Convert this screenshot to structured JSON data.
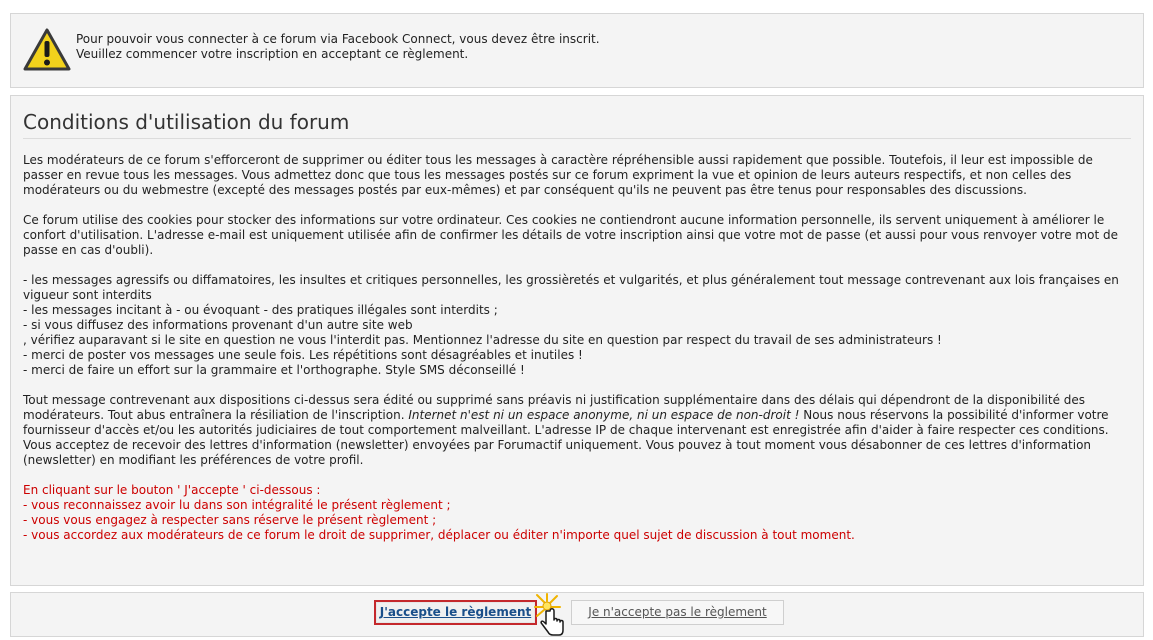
{
  "notice": {
    "icon": "warning-icon",
    "line1": "Pour pouvoir vous connecter à ce forum via Facebook Connect, vous devez être inscrit.",
    "line2": "Veuillez commencer votre inscription en acceptant ce règlement."
  },
  "terms": {
    "title": "Conditions d'utilisation du forum",
    "p1": "Les modérateurs de ce forum s'efforceront de supprimer ou éditer tous les messages à caractère répréhensible aussi rapidement que possible. Toutefois, il leur est impossible de passer en revue tous les messages. Vous admettez donc que tous les messages postés sur ce forum expriment la vue et opinion de leurs auteurs respectifs, et non celles des modérateurs ou du webmestre (excepté des messages postés par eux-mêmes) et par conséquent qu'ils ne peuvent pas être tenus pour responsables des discussions.",
    "p2": "Ce forum utilise des cookies pour stocker des informations sur votre ordinateur. Ces cookies ne contiendront aucune information personnelle, ils servent uniquement à améliorer le confort d'utilisation. L'adresse e-mail est uniquement utilisée afin de confirmer les détails de votre inscription ainsi que votre mot de passe (et aussi pour vous renvoyer votre mot de passe en cas d'oubli).",
    "rules": [
      "- les messages agressifs ou diffamatoires, les insultes et critiques personnelles, les grossièretés et vulgarités, et plus généralement tout message contrevenant aux lois françaises en vigueur sont interdits",
      "- les messages incitant à - ou évoquant - des pratiques illégales sont interdits ;",
      "- si vous diffusez des informations provenant d'un autre site web",
      ", vérifiez auparavant si le site en question ne vous l'interdit pas. Mentionnez l'adresse du site en question par respect du travail de ses administrateurs !",
      "- merci de poster vos messages une seule fois. Les répétitions sont désagréables et inutiles !",
      "- merci de faire un effort sur la grammaire et l'orthographe. Style SMS déconseillé !"
    ],
    "p3_a": "Tout message contrevenant aux dispositions ci-dessus sera édité ou supprimé sans préavis ni justification supplémentaire dans des délais qui dépendront de la disponibilité des modérateurs. Tout abus entraînera la résiliation de l'inscription. ",
    "p3_italic": "Internet n'est ni un espace anonyme, ni un espace de non-droit !",
    "p3_b": " Nous nous réservons la possibilité d'informer votre fournisseur d'accès et/ou les autorités judiciaires de tout comportement malveillant. L'adresse IP de chaque intervenant est enregistrée afin d'aider à faire respecter ces conditions.",
    "p4": "Vous acceptez de recevoir des lettres d'information (newsletter) envoyées par Forumactif uniquement. Vous pouvez à tout moment vous désabonner de ces lettres d'information (newsletter) en modifiant les préférences de votre profil.",
    "red": [
      "En cliquant sur le bouton ' J'accepte ' ci-dessous :",
      "- vous reconnaissez avoir lu dans son intégralité le présent règlement ;",
      "- vous vous engagez à respecter sans réserve le présent règlement ;",
      "- vous accordez aux modérateurs de ce forum le droit de supprimer, déplacer ou éditer n'importe quel sujet de discussion à tout moment."
    ]
  },
  "actions": {
    "accept_label": "J'accepte le règlement",
    "reject_label": "Je n'accepte pas le règlement",
    "cursor_icon": "hand-pointer-icon"
  },
  "colors": {
    "accent_red": "#cc0000",
    "link_blue": "#1a4f8a",
    "panel_bg": "#f4f4f4"
  }
}
